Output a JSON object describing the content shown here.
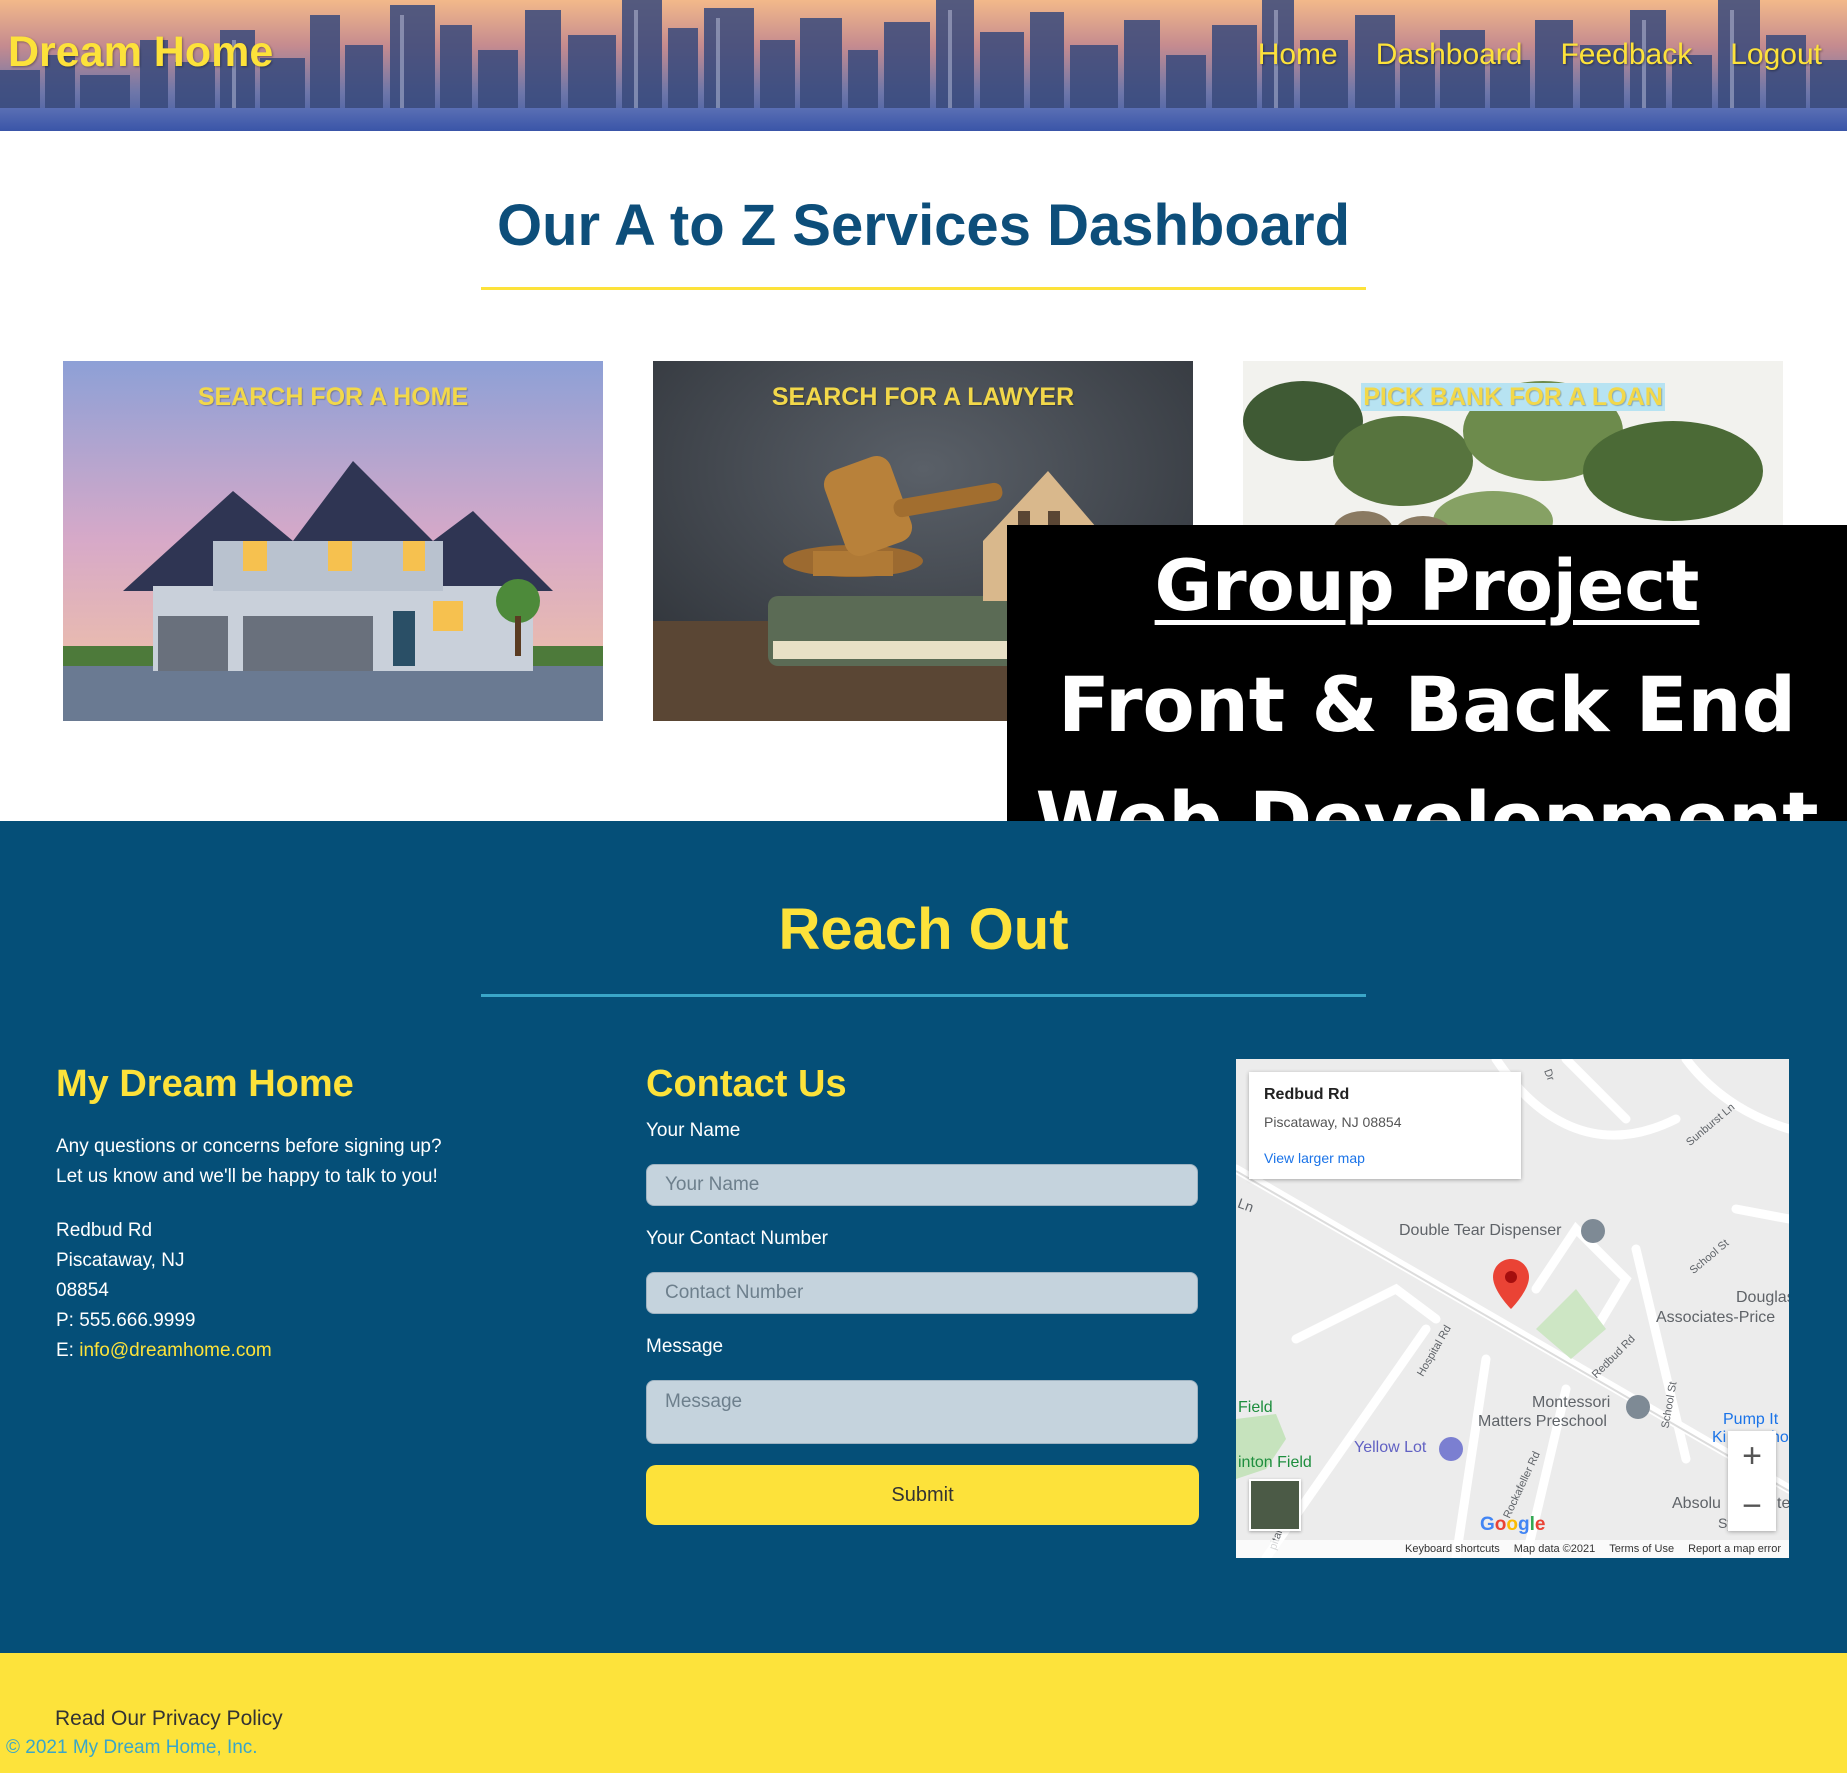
{
  "header": {
    "brand": "Dream Home",
    "nav": [
      "Home",
      "Dashboard",
      "Feedback",
      "Logout"
    ]
  },
  "services": {
    "title": "Our A to Z Services Dashboard",
    "cards": [
      {
        "label": "SEARCH FOR A HOME"
      },
      {
        "label": "SEARCH FOR A LAWYER"
      },
      {
        "label": "PICK BANK FOR A LOAN"
      }
    ]
  },
  "banner": {
    "line1": "Group Project",
    "line2": "Front & Back End",
    "line3": "Web Development"
  },
  "reach": {
    "title": "Reach Out",
    "about": {
      "title": "My Dream Home",
      "line1": "Any questions or concerns before signing up?",
      "line2": "Let us know and we'll be happy to talk to you!",
      "street": "Redbud Rd",
      "city": "Piscataway, NJ",
      "zip": "08854",
      "phone": "P: 555.666.9999",
      "email_prefix": "E: ",
      "email": "info@dreamhome.com"
    },
    "contact": {
      "title": "Contact Us",
      "name_label": "Your Name",
      "name_placeholder": "Your Name",
      "number_label": "Your Contact Number",
      "number_placeholder": "Contact Number",
      "message_label": "Message",
      "message_placeholder": "Message",
      "submit": "Submit"
    },
    "map": {
      "place_title": "Redbud Rd",
      "place_address": "Piscataway, NJ 08854",
      "larger_map": "View larger map",
      "labels": {
        "double_tear": "Double Tear Dispenser",
        "douglas": "Douglas",
        "associates": "Associates-Price",
        "montessori": "Montessori",
        "matters": "Matters Preschool",
        "yellow_lot": "Yellow Lot",
        "field": "Field",
        "inton_field": "inton Field",
        "pump_it": "Pump It",
        "ki": "Ki",
        "ho": "ho",
        "absolu": "Absolu",
        "systems": "Systems",
        "te": "te",
        "redbud": "Redbud Rd",
        "hospital": "Hospital Rd",
        "rockafeller": "Rockafeller Rd",
        "school1": "School St",
        "school2": "School St",
        "sunburst": "Sunburst Ln",
        "dr": "Dr",
        "ln": "Ln",
        "pital": "pital"
      },
      "zoom_in": "+",
      "zoom_out": "−",
      "google": [
        "G",
        "o",
        "o",
        "g",
        "l",
        "e"
      ],
      "footer": [
        "Keyboard shortcuts",
        "Map data ©2021",
        "Terms of Use",
        "Report a map error"
      ]
    }
  },
  "footer": {
    "privacy": "Read Our Privacy Policy",
    "copyright": "© 2021 My Dream Home, Inc."
  },
  "colors": {
    "navy": "#054f78",
    "title_blue": "#0d4e7a",
    "yellow": "#fde23a",
    "link_blue": "#3aa6c8"
  }
}
